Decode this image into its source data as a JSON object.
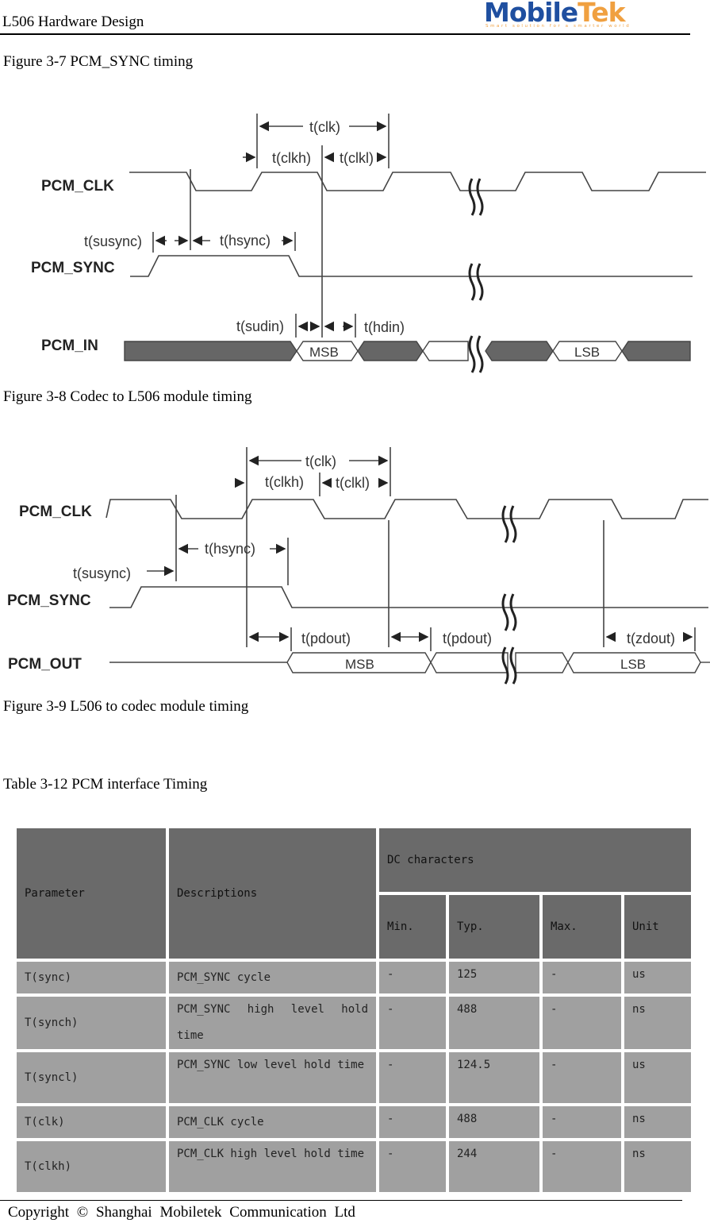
{
  "header": {
    "title": "L506 Hardware Design",
    "logo_text_1": "Mobile",
    "logo_text_2": "Tek",
    "logo_tagline": "Smart solution for a smarter world"
  },
  "captions": {
    "fig37": "Figure 3-7 PCM_SYNC timing",
    "fig38": "Figure 3-8 Codec to L506 module timing",
    "fig39": "Figure 3-9 L506 to codec module timing",
    "table312": "Table 3-12 PCM interface Timing"
  },
  "diagram1": {
    "signals": [
      "PCM_CLK",
      "PCM_SYNC",
      "PCM_IN"
    ],
    "labels": {
      "clk": "t(clk)",
      "clkh": "t(clkh)",
      "clkl": "t(clkl)",
      "susync": "t(susync)",
      "hsync": "t(hsync)",
      "sudin": "t(sudin)",
      "hdin": "t(hdin)"
    },
    "boxes": {
      "msb": "MSB",
      "lsb": "LSB"
    }
  },
  "diagram2": {
    "signals": [
      "PCM_CLK",
      "PCM_SYNC",
      "PCM_OUT"
    ],
    "labels": {
      "clk": "t(clk)",
      "clkh": "t(clkh)",
      "clkl": "t(clkl)",
      "susync": "t(susync)",
      "hsync": "t(hsync)",
      "pdout1": "t(pdout)",
      "pdout2": "t(pdout)",
      "zdout": "t(zdout)"
    },
    "boxes": {
      "msb": "MSB",
      "lsb": "LSB"
    }
  },
  "table": {
    "headers": {
      "parameter": "Parameter",
      "descriptions": "Descriptions",
      "group": "DC characters",
      "min": "Min.",
      "typ": "Typ.",
      "max": "Max.",
      "unit": "Unit"
    },
    "rows": [
      {
        "parameter": "T(sync)",
        "description": "PCM_SYNC cycle",
        "min": "-",
        "typ": "125",
        "max": "-",
        "unit": "us"
      },
      {
        "parameter": "T(synch)",
        "description": "PCM_SYNC high level hold time",
        "min": "-",
        "typ": "488",
        "max": "-",
        "unit": "ns"
      },
      {
        "parameter": "T(syncl)",
        "description": "PCM_SYNC low level hold time",
        "min": "-",
        "typ": "124.5",
        "max": "-",
        "unit": "us"
      },
      {
        "parameter": "T(clk)",
        "description": "PCM_CLK cycle",
        "min": "-",
        "typ": "488",
        "max": "-",
        "unit": "ns"
      },
      {
        "parameter": "T(clkh)",
        "description": "PCM_CLK high level hold time",
        "min": "-",
        "typ": "244",
        "max": "-",
        "unit": "ns"
      }
    ]
  },
  "footer": {
    "copyright": "Copyright © Shanghai Mobiletek Communication Ltd"
  }
}
